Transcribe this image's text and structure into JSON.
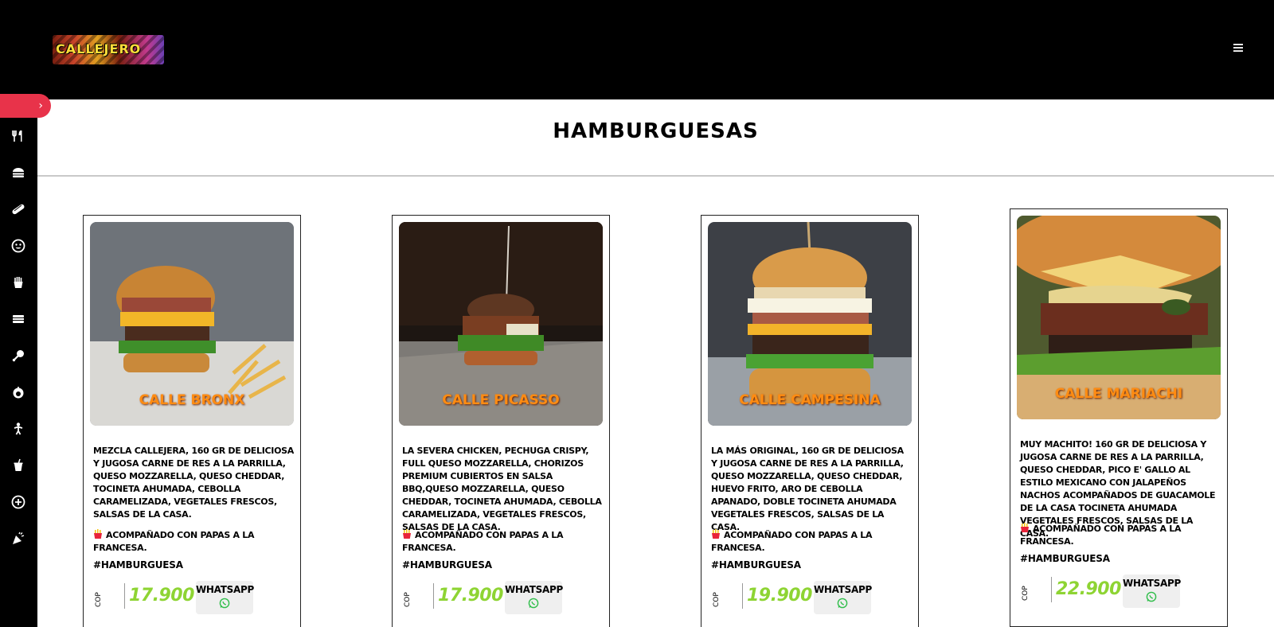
{
  "header": {
    "logo_text": "CALLEJERO",
    "menu_icon": "hamburger-menu-icon"
  },
  "siderail": {
    "toggle_icon": "chevron-right-icon",
    "items": [
      {
        "icon": "fork-knife-icon"
      },
      {
        "icon": "burger-icon"
      },
      {
        "icon": "hotdog-icon"
      },
      {
        "icon": "smiley-icon"
      },
      {
        "icon": "fries-icon"
      },
      {
        "icon": "sandwich-icon"
      },
      {
        "icon": "drumstick-icon"
      },
      {
        "icon": "cupcake-icon"
      },
      {
        "icon": "child-icon"
      },
      {
        "icon": "drink-icon"
      },
      {
        "icon": "add-circle-icon"
      },
      {
        "icon": "party-icon"
      }
    ]
  },
  "section": {
    "title": "HAMBURGUESAS"
  },
  "products": [
    {
      "name": "CALLE BRONX",
      "description": "Mezcla callejera, 160 gr de deliciosa y jugosa carne de res a la parrilla, queso mozzarella, queso cheddar, tocineta ahumada, cebolla caramelizada, vegetales frescos, salsas de la casa.",
      "side": "Acompañado con papas a la francesa.",
      "hashtag": "#HAMBURGUESA",
      "currency": "COP",
      "price": "17.900",
      "whatsapp_label": "WHATSAPP"
    },
    {
      "name": "CALLE PICASSO",
      "description": "La severa chicken, pechuga crispy, full queso mozzarella, chorizos premium cubiertos en salsa BBQ,queso mozzarella, queso cheddar, tocineta ahumada, cebolla caramelizada, vegetales frescos, salsas de la casa.",
      "side": "Acompañado con papas a la francesa.",
      "hashtag": "#HAMBURGUESA",
      "currency": "COP",
      "price": "17.900",
      "whatsapp_label": "WHATSAPP"
    },
    {
      "name": "CALLE CAMPESINA",
      "description": "La más original, 160 gr de deliciosa y jugosa carne de res a la parrilla, queso mozzarella, queso cheddar, huevo frito, aro de cebolla apanado, doble tocineta ahumada vegetales frescos, salsas de la casa.",
      "side": "Acompañado con papas a la francesa.",
      "hashtag": "#HAMBURGUESA",
      "currency": "COP",
      "price": "19.900",
      "whatsapp_label": "WHATSAPP"
    },
    {
      "name": "CALLE MARIACHI",
      "description": "Muy machito! 160 gr de deliciosa y jugosa carne de res a la parrilla, queso cheddar, pico e' gallo al estilo mexicano con jalapeños nachos acompañados de guacamole de la casa tocineta ahumada vegetales frescos, salsas de la casa.",
      "side": "Acompañado con papas a la francesa.",
      "hashtag": "#HAMBURGUESA",
      "currency": "COP",
      "price": "22.900",
      "whatsapp_label": "WHATSAPP"
    }
  ]
}
